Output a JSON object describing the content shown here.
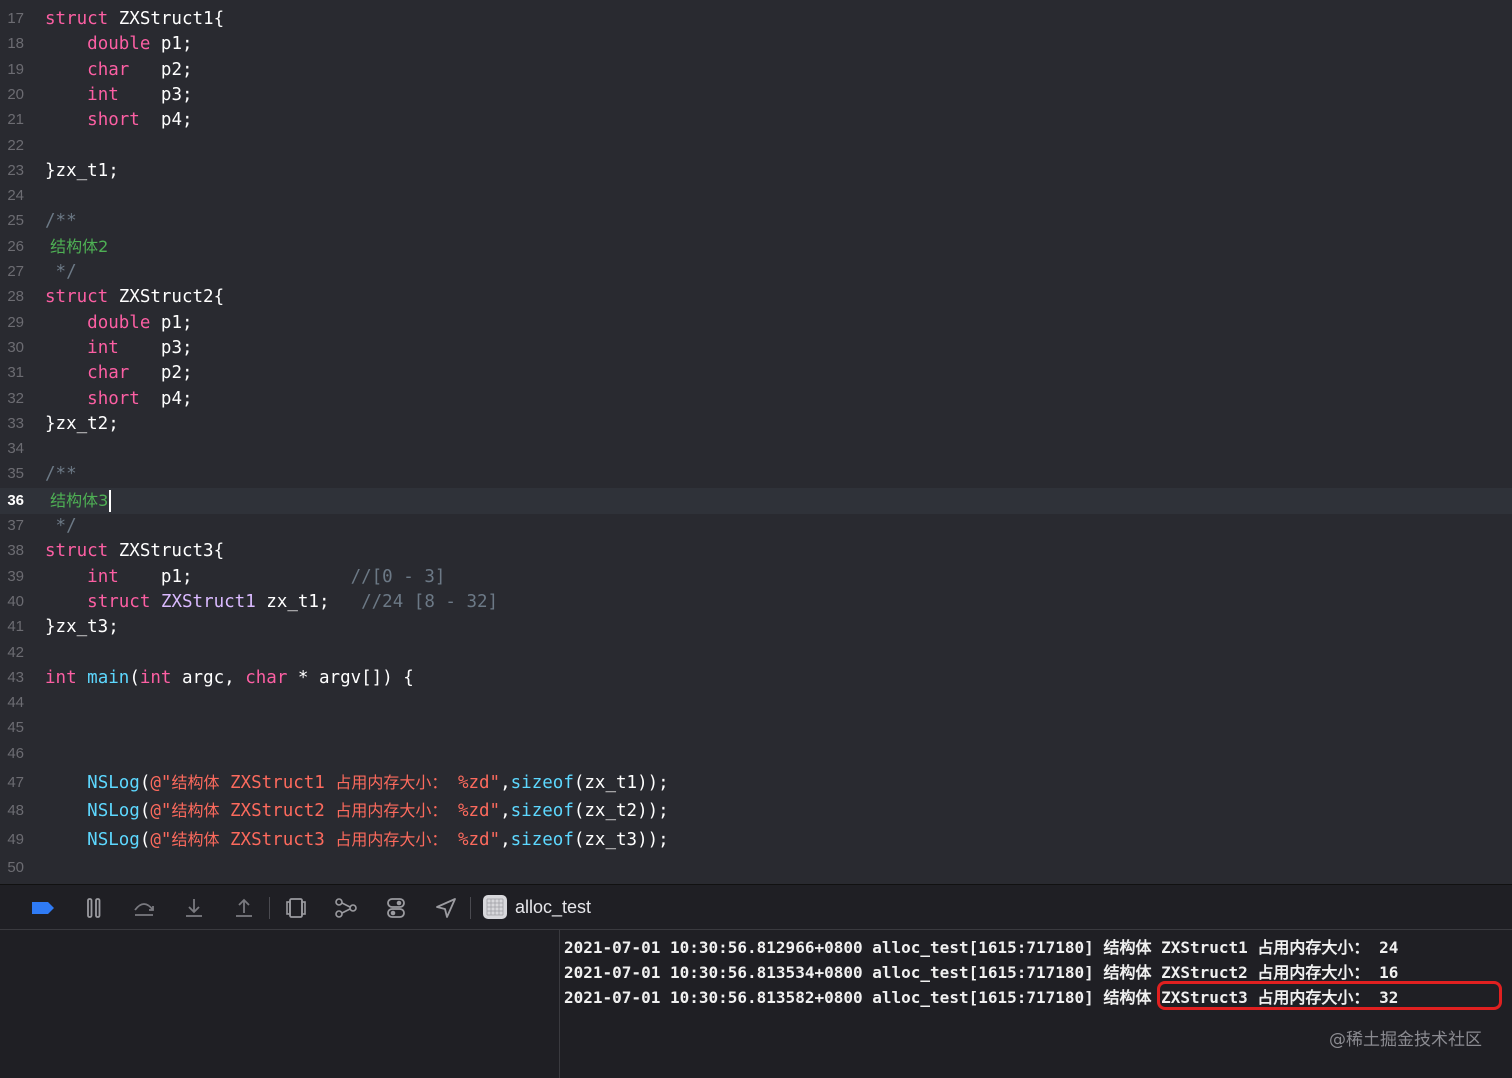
{
  "editor": {
    "current_line": 36,
    "lines": [
      {
        "n": "17",
        "text": "struct ZXStruct1{"
      },
      {
        "n": "18",
        "text": "    double p1;"
      },
      {
        "n": "19",
        "text": "    char   p2;"
      },
      {
        "n": "20",
        "text": "    int    p3;"
      },
      {
        "n": "21",
        "text": "    short  p4;"
      },
      {
        "n": "22",
        "text": ""
      },
      {
        "n": "23",
        "text": "}zx_t1;"
      },
      {
        "n": "24",
        "text": ""
      },
      {
        "n": "25",
        "text": "/**"
      },
      {
        "n": "26",
        "text": " 结构体2"
      },
      {
        "n": "27",
        "text": " */"
      },
      {
        "n": "28",
        "text": "struct ZXStruct2{"
      },
      {
        "n": "29",
        "text": "    double p1;"
      },
      {
        "n": "30",
        "text": "    int    p3;"
      },
      {
        "n": "31",
        "text": "    char   p2;"
      },
      {
        "n": "32",
        "text": "    short  p4;"
      },
      {
        "n": "33",
        "text": "}zx_t2;"
      },
      {
        "n": "34",
        "text": ""
      },
      {
        "n": "35",
        "text": "/**"
      },
      {
        "n": "36",
        "text": " 结构体3"
      },
      {
        "n": "37",
        "text": " */"
      },
      {
        "n": "38",
        "text": "struct ZXStruct3{"
      },
      {
        "n": "39",
        "text": "    int    p1;               //[0 - 3]"
      },
      {
        "n": "40",
        "text": "    struct ZXStruct1 zx_t1;   //24 [8 - 32]"
      },
      {
        "n": "41",
        "text": "}zx_t3;"
      },
      {
        "n": "42",
        "text": ""
      },
      {
        "n": "43",
        "text": "int main(int argc, char * argv[]) {"
      },
      {
        "n": "44",
        "text": ""
      },
      {
        "n": "45",
        "text": ""
      },
      {
        "n": "46",
        "text": ""
      },
      {
        "n": "47",
        "text": "    NSLog(@\"结构体 ZXStruct1 占用内存大小： %zd\",sizeof(zx_t1));"
      },
      {
        "n": "48",
        "text": "    NSLog(@\"结构体 ZXStruct2 占用内存大小： %zd\",sizeof(zx_t2));"
      },
      {
        "n": "49",
        "text": "    NSLog(@\"结构体 ZXStruct3 占用内存大小： %zd\",sizeof(zx_t3));"
      },
      {
        "n": "50",
        "text": ""
      }
    ]
  },
  "debugbar": {
    "scheme_label": "alloc_test",
    "icons": [
      "breakpoint-toggle-icon",
      "pause-icon",
      "step-over-icon",
      "step-into-icon",
      "step-out-icon",
      "view-debugger-icon",
      "memory-graph-icon",
      "environment-overrides-icon",
      "simulate-location-icon",
      "app-icon"
    ]
  },
  "console": {
    "lines": [
      {
        "prefix": "2021-07-01 10:30:56.812966+0800 alloc_test[1615:717180] ",
        "cn1": "结构体",
        "mid": " ZXStruct1 ",
        "cn2": "占用内存大小：",
        "val": " 24"
      },
      {
        "prefix": "2021-07-01 10:30:56.813534+0800 alloc_test[1615:717180] ",
        "cn1": "结构体",
        "mid": " ZXStruct2 ",
        "cn2": "占用内存大小：",
        "val": " 16"
      },
      {
        "prefix": "2021-07-01 10:30:56.813582+0800 alloc_test[1615:717180] ",
        "cn1": "结构体",
        "mid": " ZXStruct3 ",
        "cn2": "占用内存大小：",
        "val": " 32"
      }
    ],
    "highlight_color": "#e02020"
  },
  "watermark": "@稀土掘金技术社区"
}
